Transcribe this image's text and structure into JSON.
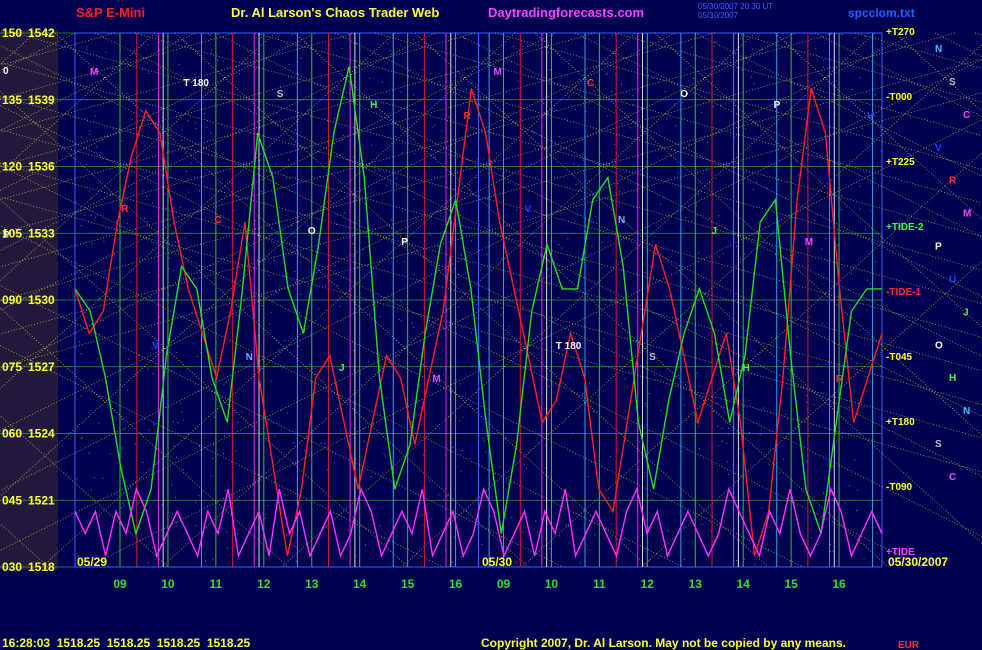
{
  "header": {
    "symbol": "S&P E-Mini",
    "title": "Dr. Al Larson's Chaos Trader Web",
    "site": "Daytradingforecasts.com",
    "file": "spcclom.txt",
    "stamp1": "05/30/2007 20:30 UT",
    "stamp2": "05/30/2007"
  },
  "colors": {
    "background": "#000050",
    "red_line": "#ff2020",
    "green_line": "#20e020",
    "magenta_line": "#ff30ff",
    "yellow_text": "#ffff30",
    "red_text": "#ff2020"
  },
  "footer": {
    "quote": "16:28:03  1518.25  1518.25  1518.25  1518.25",
    "copyright": "Copyright 2007, Dr. Al Larson. May not be copied by any means.",
    "corner": "EUR"
  },
  "chart_data": {
    "type": "line",
    "date_left": "05/29",
    "date_mid": "05/30",
    "date_right": "05/30/2007",
    "price_axis": [
      {
        "left": "150",
        "right": "1542"
      },
      {
        "left": "135",
        "right": "1539"
      },
      {
        "left": "120",
        "right": "1536"
      },
      {
        "left": "105",
        "right": "1533"
      },
      {
        "left": "090",
        "right": "1530"
      },
      {
        "left": "075",
        "right": "1527"
      },
      {
        "left": "060",
        "right": "1524"
      },
      {
        "left": "045",
        "right": "1521"
      },
      {
        "left": "030",
        "right": "1518"
      }
    ],
    "ylim": [
      1518,
      1542
    ],
    "hour_ticks": [
      "09",
      "10",
      "11",
      "12",
      "13",
      "14",
      "15",
      "16",
      "09",
      "10",
      "11",
      "12",
      "13",
      "14",
      "15",
      "16"
    ],
    "right_labels": [
      {
        "text": "+T270",
        "color": "#ffff30"
      },
      {
        "text": "-T000",
        "color": "#ffff30"
      },
      {
        "text": "+T225",
        "color": "#ffff30"
      },
      {
        "text": "+TIDE-2",
        "color": "#40ff40"
      },
      {
        "text": "-TIDE-1",
        "color": "#ff3030"
      },
      {
        "text": "-T045",
        "color": "#ffff30"
      },
      {
        "text": "+T180",
        "color": "#ffff30"
      },
      {
        "text": "-T090",
        "color": "#ffff30"
      },
      {
        "text": "+TIDE",
        "color": "#ff40ff"
      }
    ],
    "planet_markers": [
      {
        "text": "N",
        "color": "#40c0ff"
      },
      {
        "text": "S",
        "color": "#c0c0c0"
      },
      {
        "text": "C",
        "color": "#ff40ff"
      },
      {
        "text": "V",
        "color": "#2040ff"
      },
      {
        "text": "R",
        "color": "#ff3030"
      },
      {
        "text": "M",
        "color": "#ff40ff"
      },
      {
        "text": "P",
        "color": "#ffffff"
      },
      {
        "text": "U",
        "color": "#2040ff"
      },
      {
        "text": "J",
        "color": "#40ff40"
      },
      {
        "text": "O",
        "color": "#ffffff"
      },
      {
        "text": "H",
        "color": "#40ff40"
      },
      {
        "text": "N",
        "color": "#40c0ff"
      },
      {
        "text": "S",
        "color": "#c0c0c0"
      },
      {
        "text": "C",
        "color": "#ff40ff"
      }
    ],
    "in_chart_markers": [
      {
        "text": "M",
        "color": "#ff40ff"
      },
      {
        "text": "R",
        "color": "#ff3030"
      },
      {
        "text": "V",
        "color": "#2040ff"
      },
      {
        "text": "T 180",
        "color": "#ffffff"
      },
      {
        "text": "C",
        "color": "#ff3030"
      },
      {
        "text": "N",
        "color": "#40c0ff"
      },
      {
        "text": "S",
        "color": "#c0c0c0"
      },
      {
        "text": "O",
        "color": "#ffffff"
      },
      {
        "text": "J",
        "color": "#40ff40"
      },
      {
        "text": "H",
        "color": "#40ff40"
      },
      {
        "text": "P",
        "color": "#ffffff"
      },
      {
        "text": "M",
        "color": "#ff40ff"
      },
      {
        "text": "R",
        "color": "#ff3030"
      },
      {
        "text": "M",
        "color": "#ff40ff"
      },
      {
        "text": "V",
        "color": "#2040ff"
      },
      {
        "text": "T 180",
        "color": "#ffffff"
      },
      {
        "text": "C",
        "color": "#ff3030"
      },
      {
        "text": "N",
        "color": "#40c0ff"
      },
      {
        "text": "S",
        "color": "#c0c0c0"
      },
      {
        "text": "O",
        "color": "#ffffff"
      },
      {
        "text": "J",
        "color": "#40ff40"
      },
      {
        "text": "H",
        "color": "#40ff40"
      },
      {
        "text": "P",
        "color": "#ffffff"
      },
      {
        "text": "M",
        "color": "#ff40ff"
      },
      {
        "text": "R",
        "color": "#ff3030"
      },
      {
        "text": "V",
        "color": "#2040ff"
      }
    ],
    "left_markers": [
      "0",
      "P"
    ],
    "series": [
      {
        "color": "#ff2020",
        "values": [
          1530.5,
          1528.5,
          1529.5,
          1533.5,
          1536.5,
          1538.5,
          1537.5,
          1533.5,
          1530.5,
          1528.5,
          1526.5,
          1529.5,
          1533.5,
          1526.5,
          1522.5,
          1518.5,
          1521.5,
          1526.5,
          1527.5,
          1524.5,
          1521.5,
          1524.5,
          1527.5,
          1526.5,
          1523.5,
          1526.5,
          1529.5,
          1534.5,
          1539.5,
          1537.5,
          1533.5,
          1530.5,
          1527.5,
          1524.5,
          1525.5,
          1528.5,
          1526.5,
          1521.5,
          1520.5,
          1524.5,
          1528.5,
          1532.5,
          1530.5,
          1527.5,
          1524.5,
          1526.5,
          1528.5,
          1524.5,
          1518.5,
          1520.5,
          1526.5,
          1534.5,
          1539.5,
          1537.5,
          1530.5,
          1524.5,
          1526.5,
          1528.5
        ]
      },
      {
        "color": "#20e020",
        "values": [
          1530.5,
          1529.5,
          1526.5,
          1522.5,
          1519.5,
          1521.5,
          1527.5,
          1531.5,
          1530.5,
          1526.5,
          1524.5,
          1530.5,
          1537.5,
          1535.5,
          1530.5,
          1528.5,
          1532.5,
          1537.5,
          1540.5,
          1535.5,
          1526.5,
          1521.5,
          1523.5,
          1528.5,
          1532.5,
          1534.5,
          1530.5,
          1524.5,
          1519.5,
          1523.5,
          1529.5,
          1532.5,
          1530.5,
          1530.5,
          1534.5,
          1535.5,
          1531.5,
          1524.5,
          1521.5,
          1525.5,
          1528.5,
          1530.5,
          1528.5,
          1524.5,
          1527.5,
          1533.5,
          1534.5,
          1527.5,
          1521.5,
          1519.5,
          1524.5,
          1529.5,
          1530.5,
          1530.5
        ]
      },
      {
        "color": "#ff30ff",
        "values": [
          1520.5,
          1519.5,
          1520.5,
          1518.5,
          1520.5,
          1519.5,
          1521.5,
          1520.5,
          1518.5,
          1519.5,
          1520.5,
          1519.5,
          1518.5,
          1520.5,
          1519.5,
          1521.5,
          1518.5,
          1519.5,
          1520.5,
          1518.5,
          1521.5,
          1519.5,
          1520.5,
          1518.5,
          1519.5,
          1520.5,
          1518.5,
          1519.5,
          1521.5,
          1520.5,
          1518.5,
          1519.5,
          1520.5,
          1519.5,
          1521.5,
          1518.5,
          1519.5,
          1520.5,
          1518.5,
          1519.5,
          1521.5,
          1520.5,
          1518.5,
          1519.5,
          1520.5,
          1518.5,
          1520.5,
          1519.5,
          1521.5,
          1518.5,
          1519.5,
          1520.5,
          1519.5,
          1518.5,
          1520.5,
          1521.5,
          1519.5,
          1520.5,
          1518.5,
          1519.5,
          1520.5,
          1519.5,
          1518.5,
          1519.5,
          1521.5,
          1520.5,
          1519.5,
          1518.5,
          1520.5,
          1519.5,
          1521.5,
          1519.5,
          1518.5,
          1519.5,
          1521.5,
          1520.5,
          1518.5,
          1519.5,
          1520.5,
          1519.5
        ]
      }
    ]
  }
}
